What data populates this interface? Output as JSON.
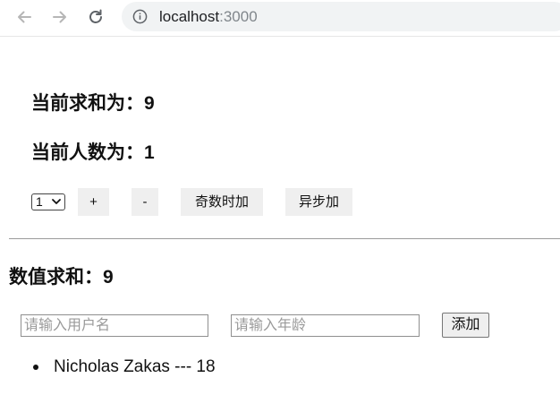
{
  "browser": {
    "url_host": "localhost",
    "url_port": ":3000"
  },
  "count": {
    "sum_label": "当前求和为：",
    "sum_value": "9",
    "people_label": "当前人数为：",
    "people_value": "1",
    "select_value": "1",
    "buttons": {
      "plus": "+",
      "minus": "-",
      "odd": "奇数时加",
      "async": "异步加"
    }
  },
  "person": {
    "value_sum_label": "数值求和：",
    "value_sum_value": "9",
    "name_placeholder": "请输入用户名",
    "age_placeholder": "请输入年龄",
    "add_label": "添加",
    "items": [
      {
        "text": "Nicholas Zakas --- 18"
      }
    ]
  }
}
